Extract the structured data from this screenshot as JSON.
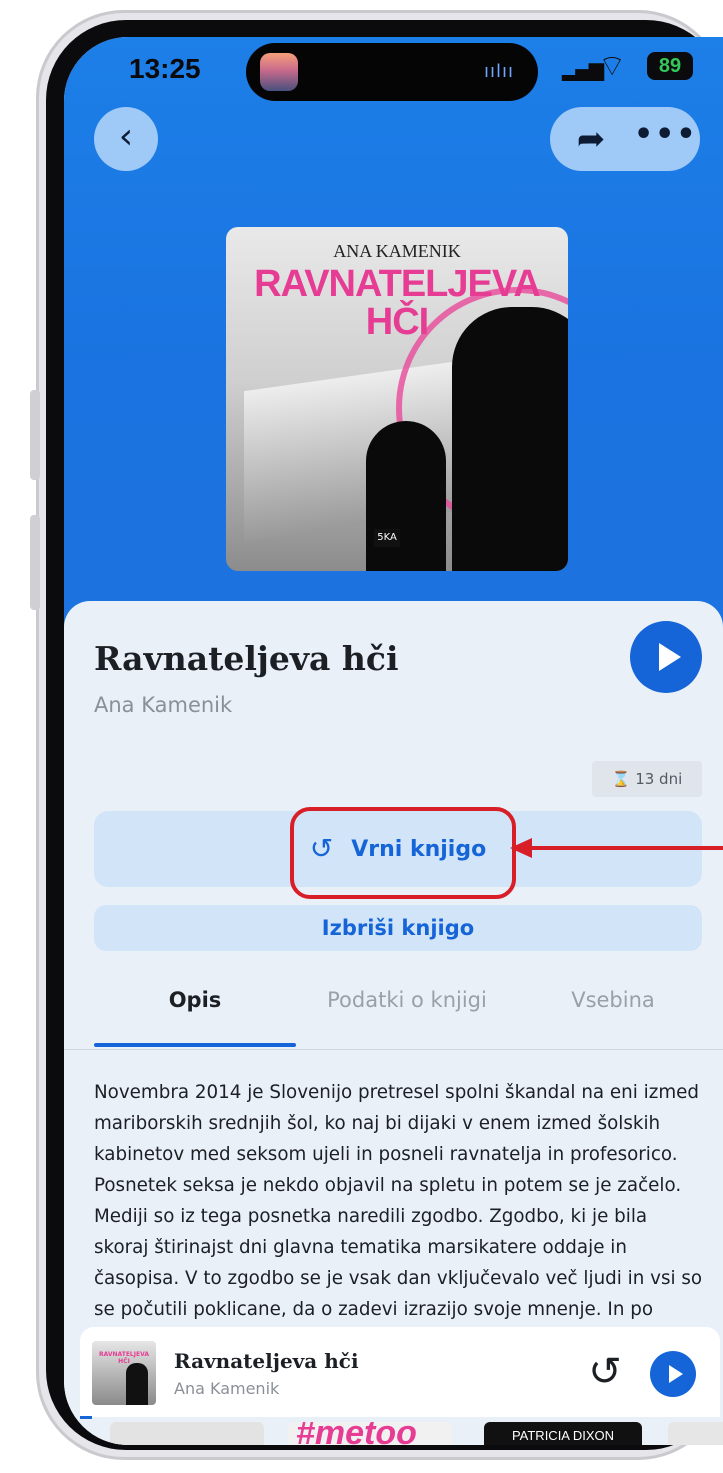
{
  "status_bar": {
    "time": "13:25",
    "battery": "89"
  },
  "cover": {
    "author": "ANA KAMENIK",
    "title_line1": "RAVNATELJEVA",
    "title_line2": "HČI",
    "publisher": "5KA"
  },
  "book": {
    "title": "Ravnateljeva hči",
    "author": "Ana Kamenik",
    "loan_remaining": "13 dni"
  },
  "actions": {
    "return_label": "Vrni knjigo",
    "delete_label": "Izbriši knjigo"
  },
  "tabs": [
    {
      "label": "Opis",
      "active": true
    },
    {
      "label": "Podatki o knjigi",
      "active": false
    },
    {
      "label": "Vsebina",
      "active": false
    }
  ],
  "description": "Novembra 2014 je Slovenijo pretresel spolni škandal na eni izmed mariborskih srednjih šol, ko naj bi dijaki v enem izmed šolskih kabinetov med seksom ujeli in posneli ravnatelja in profesorico. Posnetek seksa je nekdo objavil na spletu in potem se je začelo. Mediji so iz tega posnetka naredili zgodbo. Zgodbo, ki je bila skoraj štirinajst dni glavna tematika marsikatere oddaje in časopisa. V to zgodbo se je vsak dan vključevalo več ljudi in vsi so se počutili poklicane, da o zadevi izrazijo svoje mnenje. In po štirinajstih dneh je ta zgodba dobila tragičen epilog. Ravnatelj je storil samomor.",
  "mini_player": {
    "title": "Ravnateljeva hči",
    "author": "Ana Kamenik"
  },
  "carousel": {
    "item2_text": "#metoo",
    "item3_text": "PATRICIA DIXON"
  },
  "colors": {
    "hero_blue": "#1a73e0",
    "accent": "#1565d8",
    "annotation_red": "#d81f27"
  }
}
